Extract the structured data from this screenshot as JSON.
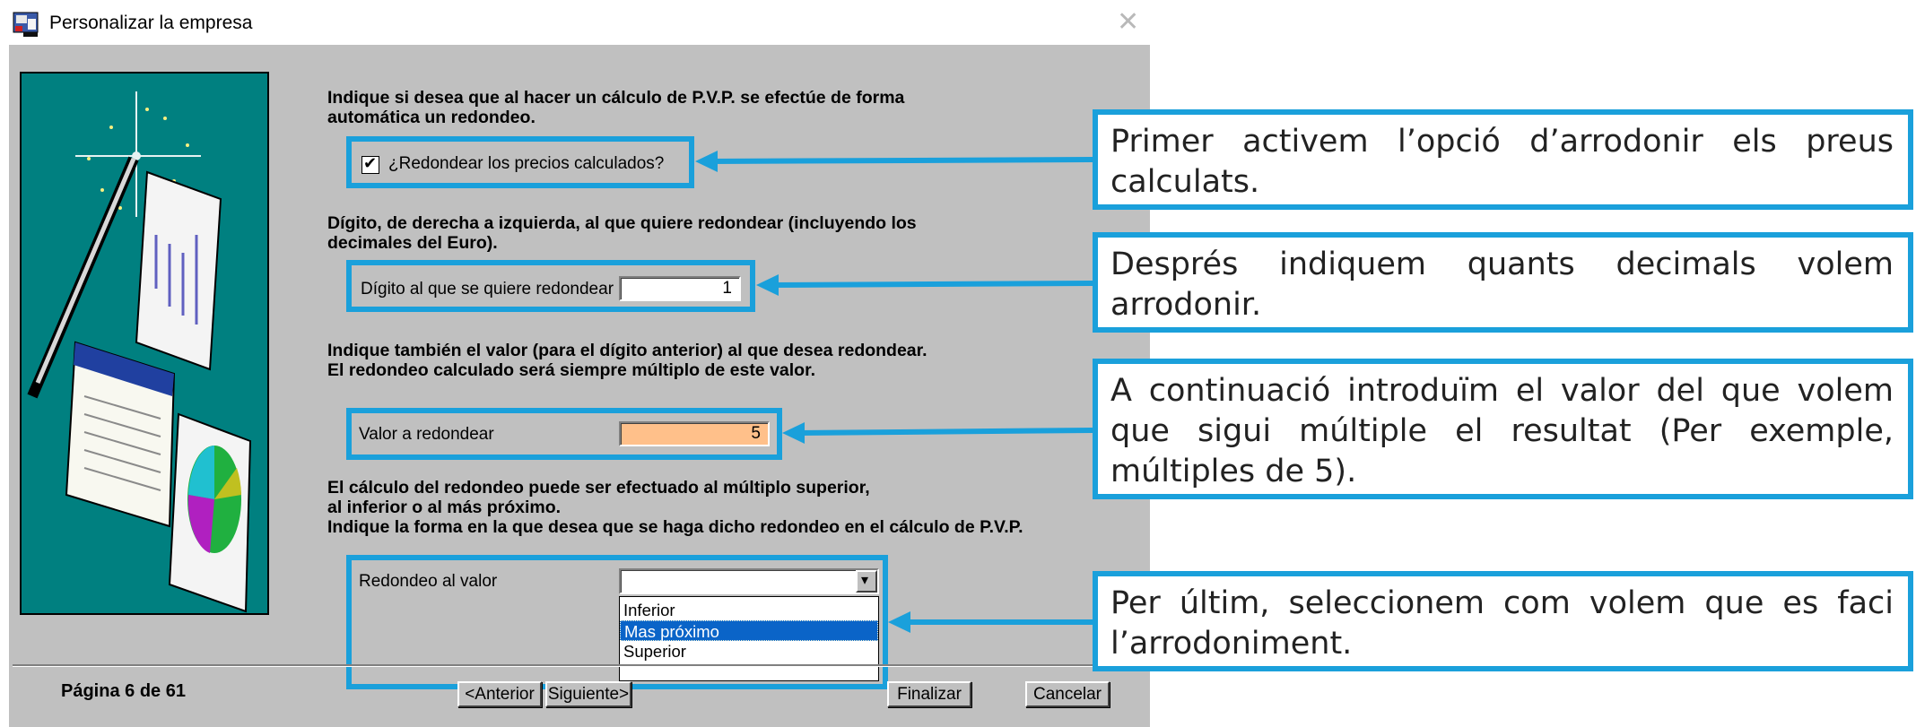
{
  "window": {
    "title": "Personalizar la empresa",
    "icon": "app-icon",
    "close_icon": "close-icon"
  },
  "instructions": {
    "rounding": "Indique si desea que al hacer un cálculo de P.V.P. se efectúe de forma\nautomática un redondeo.",
    "digit": "Dígito, de derecha a izquierda, al que quiere redondear (incluyendo los\ndecimales del Euro).",
    "value": "Indique también el valor (para el dígito anterior) al que desea redondear.\nEl redondeo calculado será siempre múltiplo de este valor.",
    "mode": "El cálculo del redondeo puede ser efectuado al múltiplo superior,\nal inferior o al más próximo.\nIndique la forma en la que desea que se haga dicho redondeo en el cálculo de P.V.P."
  },
  "controls": {
    "round_checkbox": {
      "label": "¿Redondear los precios calculados?",
      "checked": true,
      "check_glyph": "✔"
    },
    "digit": {
      "label": "Dígito al que se quiere redondear",
      "value": "1"
    },
    "value": {
      "label": "Valor a redondear",
      "value": "5",
      "highlight_color": "#ffc08a"
    },
    "mode": {
      "label": "Redondeo al valor",
      "value": "",
      "arrow_glyph": "▾",
      "options": [
        "Inferior",
        "Mas próximo",
        "Superior"
      ],
      "selected_index": 1
    }
  },
  "footer": {
    "page": "Página 6 de 61",
    "prev": "<Anterior",
    "next": "Siguiente>",
    "finish": "Finalizar",
    "cancel": "Cancelar"
  },
  "callouts": [
    "Primer activem l’opció d’arrodonir els preus calculats.",
    "Després indiquem quants decimals volem arrodonir.",
    "A continuació introduïm el valor del que volem que sigui múltiple el resultat (Per exemple, múltiples de 5).",
    "Per últim, seleccionem com volem que es faci l’arrodoniment."
  ],
  "colors": {
    "highlight": "#1aa0db",
    "dialog_bg": "#c0c0c0",
    "picture_bg": "#008080",
    "selection": "#0a64c8"
  }
}
